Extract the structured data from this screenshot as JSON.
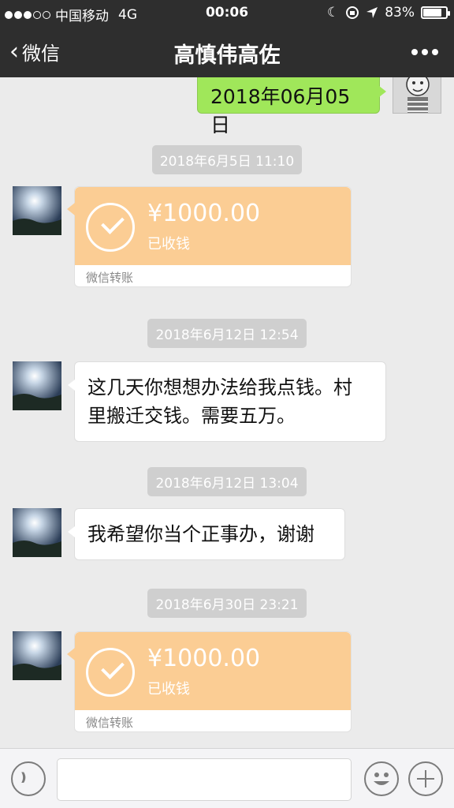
{
  "status_bar": {
    "carrier": "中国移动",
    "network": "4G",
    "time": "00:06",
    "battery": "83%",
    "battery_level": 0.83
  },
  "nav": {
    "back_label": "微信",
    "title": "高慎伟高佐"
  },
  "messages": {
    "outgoing_date_text": "2018年06月05日",
    "ts1": "2018年6月5日 11:10",
    "transfer1": {
      "amount": "¥1000.00",
      "status": "已收钱",
      "label": "微信转账"
    },
    "ts2": "2018年6月12日 12:54",
    "text1_line1": "这几天你想想办法给我点钱。村",
    "text1_line2": "里搬迁交钱。需要五万。",
    "ts3": "2018年6月12日 13:04",
    "text2": "我希望你当个正事办，谢谢",
    "ts4": "2018年6月30日 23:21",
    "transfer2": {
      "amount": "¥1000.00",
      "status": "已收钱",
      "label": "微信转账"
    }
  },
  "input": {
    "value": ""
  },
  "colors": {
    "nav_bg": "#2e2e2e",
    "chat_bg": "#ebebeb",
    "outgoing_bubble": "#a0e75a",
    "transfer_bubble": "#fbcd94"
  }
}
